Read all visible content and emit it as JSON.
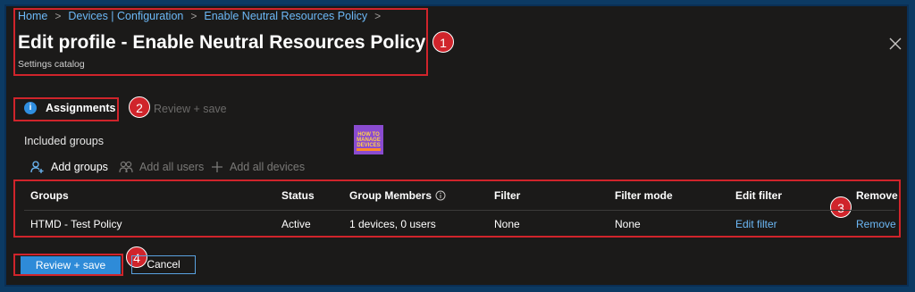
{
  "breadcrumb": {
    "items": [
      "Home",
      "Devices | Configuration",
      "Enable Neutral Resources Policy"
    ]
  },
  "header": {
    "title": "Edit profile - Enable Neutral Resources Policy",
    "subtitle": "Settings catalog"
  },
  "tabs": [
    {
      "label": "Assignments",
      "icon": "info-icon",
      "active": true
    },
    {
      "label": "Review + save",
      "active": false
    }
  ],
  "groups_section": {
    "label": "Included groups"
  },
  "commands": [
    {
      "label": "Add groups",
      "icon": "add-person-icon",
      "enabled": true
    },
    {
      "label": "Add all users",
      "icon": "people-icon",
      "enabled": false
    },
    {
      "label": "Add all devices",
      "icon": "plus-icon",
      "enabled": false
    }
  ],
  "table": {
    "columns": [
      "Groups",
      "Status",
      "Group Members",
      "Filter",
      "Filter mode",
      "Edit filter",
      "Remove"
    ],
    "rows": [
      {
        "group": "HTMD - Test Policy",
        "status": "Active",
        "members": "1 devices, 0 users",
        "filter": "None",
        "filter_mode": "None",
        "edit_filter": "Edit filter",
        "remove": "Remove"
      }
    ]
  },
  "footer": {
    "primary_label": "Review + save",
    "secondary_label": "Cancel"
  },
  "annotations": [
    "1",
    "2",
    "3",
    "4"
  ],
  "logo": {
    "text": "HOW TO MANAGE DEVICES"
  },
  "colors": {
    "background": "#1b1a19",
    "accent": "#2e8bd8",
    "link": "#6cb8f6",
    "highlight": "#d0242b"
  }
}
